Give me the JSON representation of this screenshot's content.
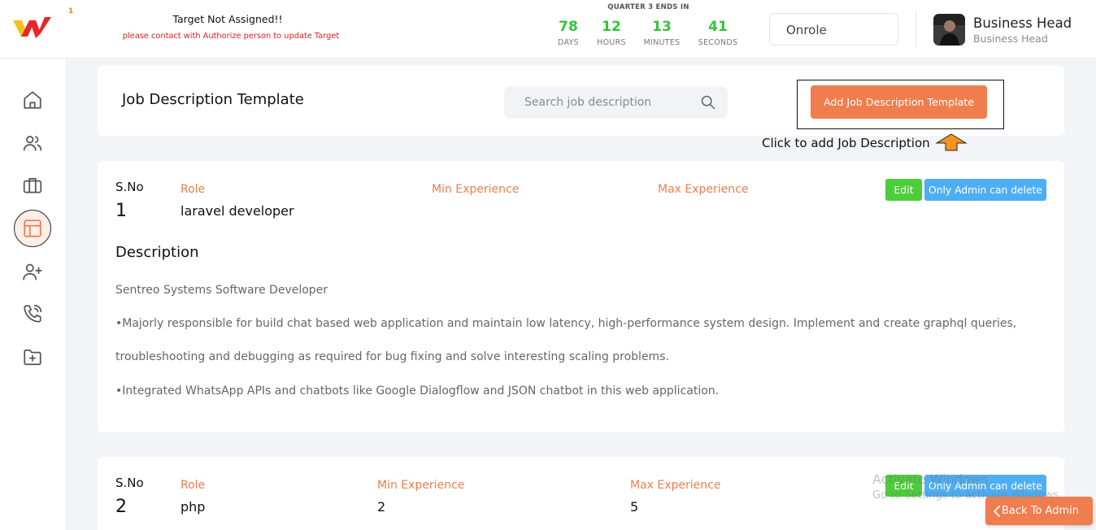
{
  "header": {
    "logo_badge": "1",
    "target_title": "Target Not Assigned!!",
    "target_subtitle": "please contact with Authorize person to update Target",
    "quarter_label": "QUARTER 3 ENDS IN",
    "countdown": [
      {
        "value": "78",
        "label": "DAYS"
      },
      {
        "value": "12",
        "label": "HOURS"
      },
      {
        "value": "13",
        "label": "MINUTES"
      },
      {
        "value": "41",
        "label": "SECONDS"
      }
    ],
    "role_select": "Onrole",
    "user_name": "Business Head",
    "user_role": "Business Head"
  },
  "sidebar": {
    "items": [
      {
        "icon": "home-icon"
      },
      {
        "icon": "users-icon"
      },
      {
        "icon": "briefcase-icon"
      },
      {
        "icon": "template-icon",
        "active": true
      },
      {
        "icon": "user-plus-icon"
      },
      {
        "icon": "phone-call-icon"
      },
      {
        "icon": "folder-plus-icon"
      }
    ]
  },
  "toolbar": {
    "title": "Job Description Template",
    "search_placeholder": "Search job description",
    "add_button": "Add Job Description Template",
    "hint": "Click to add Job Description"
  },
  "colors": {
    "accent": "#ef7d4d",
    "countdown": "#35c33a",
    "edit": "#4ccd3a",
    "delete": "#4eaef3",
    "warning_text": "#e01b1b"
  },
  "jobs": [
    {
      "sno_label": "S.No",
      "sno": "1",
      "role_label": "Role",
      "role": "laravel developer",
      "min_label": "Min Experience",
      "min": "",
      "max_label": "Max Experience",
      "max": "",
      "edit": "Edit",
      "delete": "Only Admin can delete",
      "description_title": "Description",
      "description": [
        "Sentreo Systems Software Developer",
        "•Majorly responsible for build chat based web application and maintain low latency, high-performance system design. Implement and create graphql queries,",
        "troubleshooting and debugging as required for bug fixing and solve interesting scaling problems.",
        "•Integrated WhatsApp APIs and chatbots like Google Dialogflow and JSON chatbot in this web application."
      ]
    },
    {
      "sno_label": "S.No",
      "sno": "2",
      "role_label": "Role",
      "role": "php",
      "min_label": "Min Experience",
      "min": "2",
      "max_label": "Max Experience",
      "max": "5",
      "edit": "Edit",
      "delete": "Only Admin can delete"
    }
  ],
  "watermark": {
    "line1": "Activate Windows",
    "line2": "Go to Settings to activate Windows."
  },
  "back_button": "Back To Admin"
}
